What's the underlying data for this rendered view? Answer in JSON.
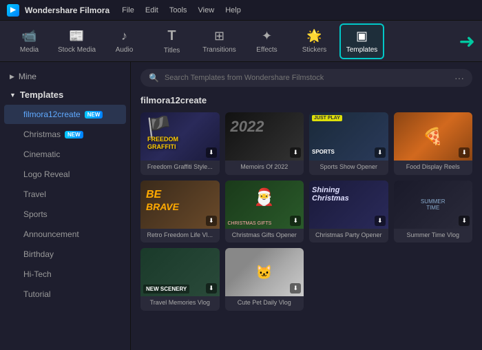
{
  "app": {
    "logo": "F",
    "name": "Wondershare Filmora",
    "menu": [
      "File",
      "Edit",
      "Tools",
      "View",
      "Help"
    ]
  },
  "toolbar": {
    "tools": [
      {
        "id": "media",
        "icon": "🎞",
        "label": "Media"
      },
      {
        "id": "stock-media",
        "icon": "📷",
        "label": "Stock Media"
      },
      {
        "id": "audio",
        "icon": "🎵",
        "label": "Audio"
      },
      {
        "id": "titles",
        "icon": "T",
        "label": "Titles"
      },
      {
        "id": "transitions",
        "icon": "⊞",
        "label": "Transitions"
      },
      {
        "id": "effects",
        "icon": "✦",
        "label": "Effects"
      },
      {
        "id": "stickers",
        "icon": "🎀",
        "label": "Stickers"
      },
      {
        "id": "templates",
        "icon": "▣",
        "label": "Templates",
        "active": true
      }
    ]
  },
  "sidebar": {
    "mine_label": "Mine",
    "group_label": "Templates",
    "items": [
      {
        "id": "filmora12create",
        "label": "filmora12create",
        "badge": "NEW",
        "active": true
      },
      {
        "id": "christmas",
        "label": "Christmas",
        "badge": "NEW"
      },
      {
        "id": "cinematic",
        "label": "Cinematic"
      },
      {
        "id": "logo-reveal",
        "label": "Logo Reveal"
      },
      {
        "id": "travel",
        "label": "Travel"
      },
      {
        "id": "sports",
        "label": "Sports"
      },
      {
        "id": "announcement",
        "label": "Announcement"
      },
      {
        "id": "birthday",
        "label": "Birthday"
      },
      {
        "id": "hi-tech",
        "label": "Hi-Tech"
      },
      {
        "id": "tutorial",
        "label": "Tutorial"
      }
    ]
  },
  "content": {
    "section_title": "filmora12create",
    "search_placeholder": "Search Templates from Wondershare Filmstock",
    "templates": [
      {
        "id": "freedom",
        "label": "Freedom Graffiti Style...",
        "theme": "freedom"
      },
      {
        "id": "memoirs",
        "label": "Memoirs Of 2022",
        "theme": "memoirs"
      },
      {
        "id": "sports",
        "label": "Sports Show Opener",
        "theme": "sports"
      },
      {
        "id": "food",
        "label": "Food Display Reels",
        "theme": "food"
      },
      {
        "id": "retro",
        "label": "Retro Freedom Life Vl...",
        "theme": "retro"
      },
      {
        "id": "christmas-gifts",
        "label": "Christmas Gifts Opener",
        "theme": "christmas"
      },
      {
        "id": "christmas-party",
        "label": "Christmas Party Opener",
        "theme": "christmas2"
      },
      {
        "id": "summer",
        "label": "Summer Time Vlog",
        "theme": "summer"
      },
      {
        "id": "travel",
        "label": "Travel Memories Vlog",
        "theme": "travel"
      },
      {
        "id": "pet",
        "label": "Cute Pet Daily Vlog",
        "theme": "pet"
      }
    ]
  }
}
